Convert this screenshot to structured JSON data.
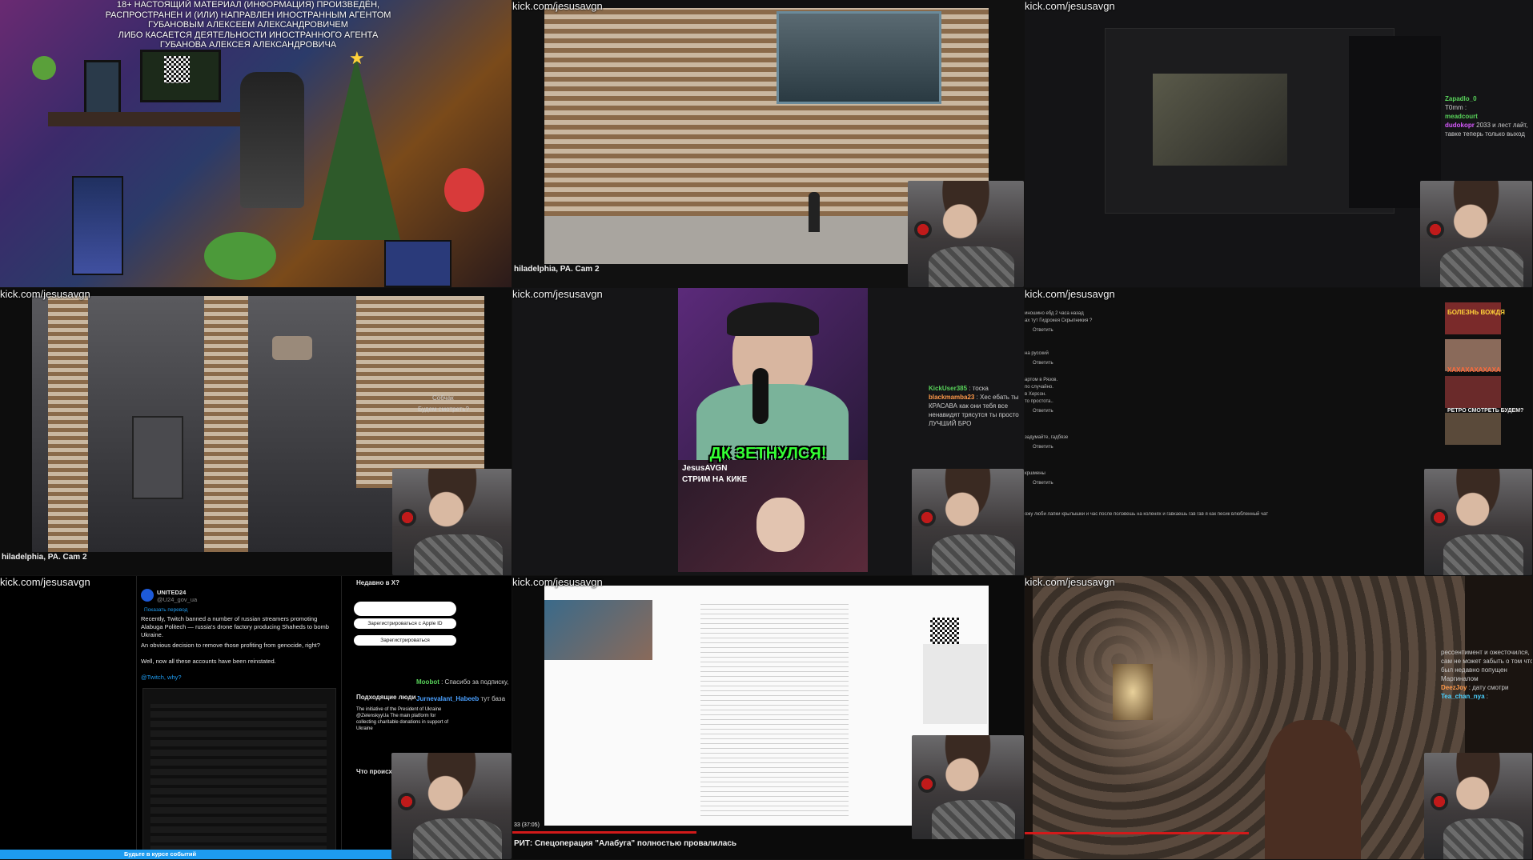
{
  "watermark": "kick.com/jesusavgn",
  "tile1": {
    "warning_lines": [
      "18+ НАСТОЯЩИЙ МАТЕРИАЛ (ИНФОРМАЦИЯ) ПРОИЗВЕДЁН,",
      "РАСПРОСТРАНЕН И (ИЛИ) НАПРАВЛЕН ИНОСТРАННЫМ АГЕНТОМ",
      "ГУБАНОВЫМ АЛЕКСЕЕМ АЛЕКСАНДРОВИЧЕМ",
      "ЛИБО КАСАЕТСЯ ДЕЯТЕЛЬНОСТИ ИНОСТРАННОГО АГЕНТА",
      "ГУБАНОВА АЛЕКСЕЯ АЛЕКСАНДРОВИЧА"
    ]
  },
  "tile2": {
    "caption": "hiladelphia, PA. Cam 2"
  },
  "tile3": {
    "chat": [
      {
        "user": "Zapadlo_0",
        "text": ""
      },
      {
        "user": "",
        "text": "T0mm :"
      },
      {
        "user": "meadcourt",
        "text": ""
      },
      {
        "user": "dudokopr",
        "text": "2033 и лест лайт,"
      },
      {
        "user": "",
        "text": "тавке теперь только выход"
      }
    ]
  },
  "tile4": {
    "caption": "hiladelphia, PA. Cam 2",
    "overlay_lines": [
      "Собчак",
      "Будем смотреть?"
    ]
  },
  "tile5": {
    "banner": "ДК ЗЕТНУЛСЯ!",
    "brand": "JesusAVGN",
    "sub": "СТРИМ НА КИКЕ",
    "chat": [
      {
        "user": "KickUser385",
        "text": "тоска"
      },
      {
        "user": "blackmamba23",
        "text": "Хес ебать ты"
      },
      {
        "user": "",
        "text": "КРАСАВА как они тебя все"
      },
      {
        "user": "",
        "text": "ненавидят трясутся ты просто"
      },
      {
        "user": "",
        "text": "ЛУЧШИЙ БРО"
      }
    ]
  },
  "tile6": {
    "comments": [
      "иношино ебд 2 часа назад",
      "ах тут Гидрокея Скрыпникия ?",
      "Ответить",
      "на русский",
      "Ответить",
      "артом в Рязов.",
      "по случайно.",
      "в Херсон.",
      "то простота..",
      "Ответить",
      "задумайте, гадбязе",
      "Ответить",
      "кршмены",
      "Ответить",
      "ожу люби лапки крылышки и час после полэвешь на коленях и гавкаешь гав гав я как песик влюбленный чат"
    ],
    "side_titles": [
      "БОЛЕЗНЬ ВОЖДЯ",
      "ХАХАХАХАХАХА",
      "РЕТРО СМОТРЕТЬ БУДЕМ?"
    ]
  },
  "tile7": {
    "account": "UNITED24",
    "handle": "@U24_gov_ua",
    "translate": "Показать перевод",
    "tweet_text": "Recently, Twitch banned a number of russian streamers promoting Alabuga Politech — russia's drone factory producing Shaheds to bomb Ukraine.",
    "tweet_text2": "An obvious decision to remove those profiting from genocide, right?",
    "tweet_text3": "Well, now all these accounts have been reinstated.",
    "tweet_text4": "@Twitch, why?",
    "right_title": "Недавно в X?",
    "btn_apple": "Зарегистрироваться с Apple ID",
    "btn_register": "Зарегистрироваться",
    "who_follow": "Подходящие люди",
    "follow_text": "The initiative of the President of Ukraine @ZelenskyyUa The main platform for collecting charitable donations in support of Ukraine",
    "what_happens": "Что происх",
    "bottom_bar": "Будьте в курсе событий",
    "chat": [
      {
        "user": "Moobot",
        "text": "Спасибо за подписку,"
      },
      {
        "user": "Jurnevalant_Habeeb",
        "text": "тут база"
      }
    ]
  },
  "tile8": {
    "caption": "РИТ: Спецоперация \"Алабуга\" полностью провалилась",
    "time": "33 (37:05)"
  },
  "tile9": {
    "chat": [
      {
        "user": "",
        "text": "рессентимент и ожесточился,"
      },
      {
        "user": "",
        "text": "сам не может забыть о том что"
      },
      {
        "user": "",
        "text": "был недавно попущен"
      },
      {
        "user": "",
        "text": "Маргиналом"
      },
      {
        "user": "DeezJoy",
        "text": "дату смотри"
      },
      {
        "user": "Tea_chan_nya",
        "text": ""
      }
    ]
  }
}
